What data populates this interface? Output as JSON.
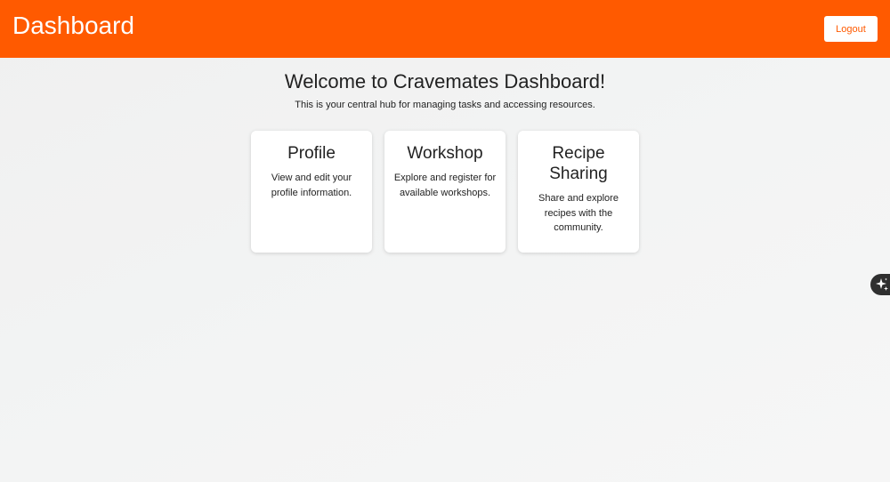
{
  "header": {
    "title": "Dashboard",
    "logout_label": "Logout",
    "background_color": "#ff5a00"
  },
  "welcome": {
    "title": "Welcome to Cravemates Dashboard!",
    "subtitle": "This is your central hub for managing tasks and accessing resources."
  },
  "cards": [
    {
      "title": "Profile",
      "description": "View and edit your profile information."
    },
    {
      "title": "Workshop",
      "description": "Explore and register for available workshops."
    },
    {
      "title": "Recipe Sharing",
      "description": "Share and explore recipes with the community."
    }
  ],
  "assistant_button": {
    "icon": "sparkle-icon"
  }
}
